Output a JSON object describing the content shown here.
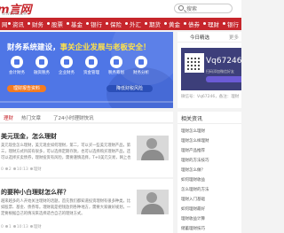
{
  "site": {
    "logo": "m言网",
    "domain": "W.WCUO.COM"
  },
  "search": {
    "label": "搜索"
  },
  "nav": [
    "网",
    "资讯",
    "财务",
    "股票",
    "基金",
    "银行",
    "保险",
    "外汇",
    "期货",
    "黄金",
    "债券",
    "理财",
    "银行",
    "专栏",
    "更多"
  ],
  "banner": {
    "title_main": "财务系统建设，",
    "title_hl": "事关企业发展与老板安全！",
    "features": [
      "会计财务",
      "融资税务",
      "企业财务",
      "资金管理",
      "税务筹划",
      "财务分析"
    ],
    "btn_left": "理财报告资料",
    "btn_right": "降低财税风险"
  },
  "side_card": {
    "tab1": "今日精选",
    "tab2": "更多",
    "wx_id": "Vq67246",
    "wx_sub": "扫码添加微信好友",
    "footer": "微信号：Vq67246，备注：理财"
  },
  "tabs": [
    "理财",
    "热门文章",
    "了24小时理财快讯"
  ],
  "articles": [
    {
      "title": "美元现金，怎么理财",
      "desc": "美元现金怎么理财，美元现金如何理财，第二，可以买一些美元理财产品，第三，理财方式目前有很多，可以选择定期存款，也可以选择购买理财产品，还可以选择买卖债券，理财投资有风险，需要谨慎选择，T+0美元交易，网上也可以进行。",
      "date": "0",
      "views": "2",
      "time": "10:13",
      "tag": "理财"
    },
    {
      "title": "的要种小白理财怎么样？",
      "desc": "越来越多的人开始关注理财的话题，首先我们都知道投资理财有很多种类，比如股票、基金、债券等。理财就是把钱放到各种地方，需要大家做好规划，一定要根据自己的情况来选择适合自己的理财方式。",
      "date": "0",
      "views": "1",
      "time": "10:13",
      "tag": "理财"
    }
  ],
  "recommend": {
    "heading": "相关资讯",
    "items": [
      "理财怎么理财",
      "理财怎么样理财",
      "理财产品推荐",
      "理财的方法技巧",
      "理财怎么做？",
      "如何理财收益",
      "怎么理财的方法",
      "理财入门基础",
      "如何理财最好",
      "理财收益计算",
      "储蓄理财技巧"
    ]
  }
}
